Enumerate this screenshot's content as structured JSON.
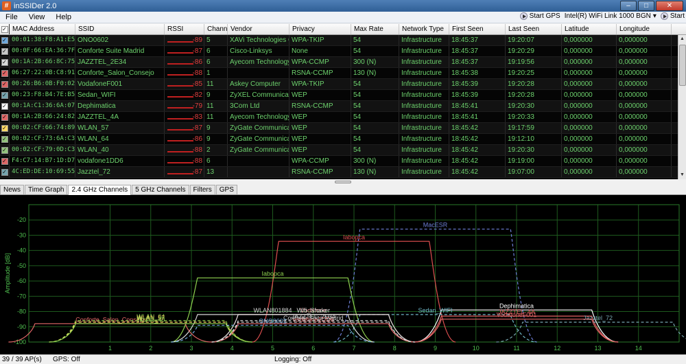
{
  "window": {
    "title": "inSSIDer 2.0",
    "icon": "inssider-app-icon"
  },
  "menu": {
    "items": [
      "File",
      "View",
      "Help"
    ]
  },
  "toolbar": {
    "start_gps": "Start GPS",
    "adapter": "Intel(R) WiFi Link 1000 BGN",
    "start": "Start"
  },
  "grid": {
    "columns": [
      "MAC Address",
      "SSID",
      "RSSI",
      "Channel",
      "Vendor",
      "Privacy",
      "Max Rate",
      "Network Type",
      "First Seen",
      "Last Seen",
      "Latitude",
      "Longitude"
    ],
    "rows": [
      {
        "color": "#6fa8dc",
        "mac": "00:01:38:F8:A1:E5",
        "ssid": "ONO0602",
        "rssi": "-89",
        "channel": "5",
        "vendor": "XAVi Technologies Co...",
        "privacy": "WPA-TKIP",
        "rate": "54",
        "type": "Infrastructure",
        "first": "18:45:37",
        "last": "19:20:07",
        "lat": "0,000000",
        "lon": "0,000000"
      },
      {
        "color": "#c8c8c8",
        "mac": "00:0F:66:EA:36:7F",
        "ssid": "Conforte Suite Madrid",
        "rssi": "-87",
        "channel": "6",
        "vendor": "Cisco-Linksys",
        "privacy": "None",
        "rate": "54",
        "type": "Infrastructure",
        "first": "18:45:37",
        "last": "19:20:29",
        "lat": "0,000000",
        "lon": "0,000000"
      },
      {
        "color": "#d9d9d9",
        "mac": "00:1A:2B:66:8C:75",
        "ssid": "JAZZTEL_2E34",
        "rssi": "-86",
        "channel": "6",
        "vendor": "Ayecom Technology ...",
        "privacy": "WPA-CCMP",
        "rate": "300 (N)",
        "type": "Infrastructure",
        "first": "18:45:37",
        "last": "19:19:56",
        "lat": "0,000000",
        "lon": "0,000000"
      },
      {
        "color": "#e06666",
        "mac": "06:27:22:0B:C8:91",
        "ssid": "Conforte_Salon_Consejo",
        "rssi": "-88",
        "channel": "1",
        "vendor": "",
        "privacy": "RSNA-CCMP",
        "rate": "130 (N)",
        "type": "Infrastructure",
        "first": "18:45:38",
        "last": "19:20:25",
        "lat": "0,000000",
        "lon": "0,000000"
      },
      {
        "color": "#e06666",
        "mac": "00:26:B6:0B:F0:02",
        "ssid": "VodafoneF001",
        "rssi": "-85",
        "channel": "11",
        "vendor": "Askey Computer",
        "privacy": "WPA-TKIP",
        "rate": "54",
        "type": "Infrastructure",
        "first": "18:45:39",
        "last": "19:20:28",
        "lat": "0,000000",
        "lon": "0,000000"
      },
      {
        "color": "#76a5af",
        "mac": "00:23:F8:B4:7E:B5",
        "ssid": "Sedan_WIFI",
        "rssi": "-82",
        "channel": "9",
        "vendor": "ZyXEL Communicatio...",
        "privacy": "WEP",
        "rate": "54",
        "type": "Infrastructure",
        "first": "18:45:39",
        "last": "19:20:28",
        "lat": "0,000000",
        "lon": "0,000000"
      },
      {
        "color": "#ffffff",
        "mac": "00:1A:C1:36:6A:07",
        "ssid": "Dephimatica",
        "rssi": "-79",
        "channel": "11",
        "vendor": "3Com Ltd",
        "privacy": "RSNA-CCMP",
        "rate": "54",
        "type": "Infrastructure",
        "first": "18:45:41",
        "last": "19:20:30",
        "lat": "0,000000",
        "lon": "0,000000"
      },
      {
        "color": "#e06666",
        "mac": "00:1A:2B:66:24:82",
        "ssid": "JAZZTEL_4A",
        "rssi": "-83",
        "channel": "11",
        "vendor": "Ayecom Technology ...",
        "privacy": "WEP",
        "rate": "54",
        "type": "Infrastructure",
        "first": "18:45:41",
        "last": "19:20:33",
        "lat": "0,000000",
        "lon": "0,000000"
      },
      {
        "color": "#ffd966",
        "mac": "00:02:CF:66:74:89",
        "ssid": "WLAN_57",
        "rssi": "-87",
        "channel": "9",
        "vendor": "ZyGate Communicatio...",
        "privacy": "WEP",
        "rate": "54",
        "type": "Infrastructure",
        "first": "18:45:42",
        "last": "19:17:59",
        "lat": "0,000000",
        "lon": "0,000000"
      },
      {
        "color": "#93c47d",
        "mac": "00:02:CF:73:6A:C3",
        "ssid": "WLAN_64",
        "rssi": "-86",
        "channel": "9",
        "vendor": "ZyGate Communicatio...",
        "privacy": "WEP",
        "rate": "54",
        "type": "Infrastructure",
        "first": "18:45:42",
        "last": "19:12:10",
        "lat": "0,000000",
        "lon": "0,000000"
      },
      {
        "color": "#93c47d",
        "mac": "00:02:CF:79:0D:C3",
        "ssid": "WLAN_40",
        "rssi": "-88",
        "channel": "2",
        "vendor": "ZyGate Communicatio...",
        "privacy": "WEP",
        "rate": "54",
        "type": "Infrastructure",
        "first": "18:45:42",
        "last": "19:20:30",
        "lat": "0,000000",
        "lon": "0,000000"
      },
      {
        "color": "#e06666",
        "mac": "F4:C7:14:B7:1D:D7",
        "ssid": "vodafone1DD6",
        "rssi": "-88",
        "channel": "6",
        "vendor": "",
        "privacy": "WPA-CCMP",
        "rate": "300 (N)",
        "type": "Infrastructure",
        "first": "18:45:42",
        "last": "19:19:00",
        "lat": "0,000000",
        "lon": "0,000000"
      },
      {
        "color": "#76a5af",
        "mac": "4C:ED:DE:10:69:55",
        "ssid": "Jazztel_72",
        "rssi": "-87",
        "channel": "13",
        "vendor": "",
        "privacy": "RSNA-CCMP",
        "rate": "130 (N)",
        "type": "Infrastructure",
        "first": "18:45:42",
        "last": "19:07:00",
        "lat": "0,000000",
        "lon": "0,000000"
      }
    ]
  },
  "tabs": [
    "News",
    "Time Graph",
    "2.4 GHz Channels",
    "5 GHz Channels",
    "Filters",
    "GPS"
  ],
  "active_tab": "2.4 GHz Channels",
  "chart_data": {
    "type": "area",
    "ylabel": "Amplitude [dB]",
    "ylim": [
      -100,
      -10
    ],
    "yticks": [
      -20,
      -30,
      -40,
      -50,
      -60,
      -70,
      -80,
      -90,
      -100
    ],
    "xlim": [
      -1,
      15
    ],
    "xticks": [
      1,
      2,
      3,
      4,
      5,
      6,
      7,
      8,
      9,
      10,
      11,
      12,
      13,
      14
    ],
    "grid": true,
    "series": [
      {
        "name": "MacESR",
        "channel": 9,
        "amp": -26,
        "color": "#6d7fd6",
        "dashed": true
      },
      {
        "name": "Iabopca",
        "channel": 7,
        "amp": -34,
        "color": "#e05050",
        "dashed": false
      },
      {
        "name": "Iabopca",
        "channel": 5,
        "amp": -58,
        "color": "#8fd14f",
        "dashed": false
      },
      {
        "name": "Dephimatica",
        "channel": 11,
        "amp": -79,
        "color": "#ffffff",
        "dashed": false
      },
      {
        "name": "Sedan_WIFI",
        "channel": 9,
        "amp": -82,
        "color": "#6fb8c8",
        "dashed": true
      },
      {
        "name": "Vodafone",
        "channel": 6,
        "amp": -82,
        "color": "#f0a0a0",
        "dashed": false
      },
      {
        "name": "JAZZTEL_4A",
        "channel": 11,
        "amp": -83,
        "color": "#e06060",
        "dashed": false
      },
      {
        "name": "Conforte Suite Madrid",
        "channel": 6,
        "amp": -87,
        "color": "#c8c8c8",
        "dashed": true
      },
      {
        "name": "WLAN801884",
        "channel": 5,
        "amp": -82,
        "color": "#d8d8d8",
        "dashed": false
      },
      {
        "name": "Wifi_Shaker",
        "channel": 6,
        "amp": -82,
        "color": "#d8d8d8",
        "dashed": false
      },
      {
        "name": "Conforte_Salon_Consejo",
        "channel": 1,
        "amp": -88,
        "color": "#e06666",
        "dashed": false
      },
      {
        "name": "WLAN_64",
        "channel": 2,
        "amp": -86,
        "color": "#8fd14f",
        "dashed": true
      },
      {
        "name": "WLAN_57",
        "channel": 2,
        "amp": -87,
        "color": "#ffd966",
        "dashed": true
      },
      {
        "name": "WLAN_40",
        "channel": 2,
        "amp": -88,
        "color": "#8fd14f",
        "dashed": false
      },
      {
        "name": "ONO0602",
        "channel": 5,
        "amp": -89,
        "color": "#6fa8dc",
        "dashed": true
      },
      {
        "name": "Jazztel_72",
        "channel": 13,
        "amp": -87,
        "color": "#76a5af",
        "dashed": true
      },
      {
        "name": "vodafone1DD6",
        "channel": 6,
        "amp": -88,
        "color": "#e06666",
        "dashed": false
      },
      {
        "name": "JAZZTEL_2E34",
        "channel": 6,
        "amp": -86,
        "color": "#d9d9d9",
        "dashed": true
      },
      {
        "name": "VodafoneF001",
        "channel": 11,
        "amp": -85,
        "color": "#e06666",
        "dashed": false
      }
    ]
  },
  "status": {
    "aps": "39 / 39 AP(s)",
    "gps": "GPS: Off",
    "logging": "Logging: Off"
  }
}
